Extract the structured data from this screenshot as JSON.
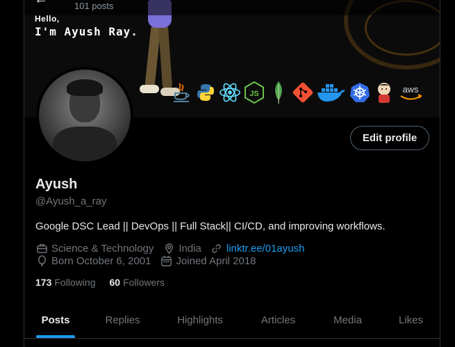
{
  "header": {
    "back_glyph": "←",
    "post_count": "101 posts"
  },
  "banner": {
    "hello": "Hello,",
    "intro": "I'm Ayush Ray.",
    "tech_icons": [
      "java-icon",
      "python-icon",
      "react-icon",
      "nodejs-icon",
      "mongodb-icon",
      "git-icon",
      "docker-icon",
      "kubernetes-icon",
      "jenkins-icon",
      "aws-icon"
    ],
    "aws_label": "aws",
    "colors": {
      "react": "#61dafb",
      "node": "#6cc24a",
      "mongo": "#4fa94d",
      "git": "#f05033",
      "docker": "#2496ed",
      "k8s": "#326ce5",
      "java": "#e76f00",
      "python_blue": "#3776ab",
      "python_yellow": "#ffd43b",
      "aws": "#ff9900"
    }
  },
  "profile": {
    "edit_label": "Edit profile",
    "display_name": "Ayush",
    "handle": "@Ayush_a_ray",
    "bio": "Google DSC Lead || DevOps || Full Stack|| CI/CD, and improving workflows.",
    "category": "Science & Technology",
    "location": "India",
    "link": "linktr.ee/01ayush",
    "born": "Born October 6, 2001",
    "joined": "Joined April 2018",
    "following_count": "173",
    "following_label": "Following",
    "followers_count": "60",
    "followers_label": "Followers"
  },
  "tabs": [
    "Posts",
    "Replies",
    "Highlights",
    "Articles",
    "Media",
    "Likes"
  ],
  "accent_color": "#1d9bf0"
}
